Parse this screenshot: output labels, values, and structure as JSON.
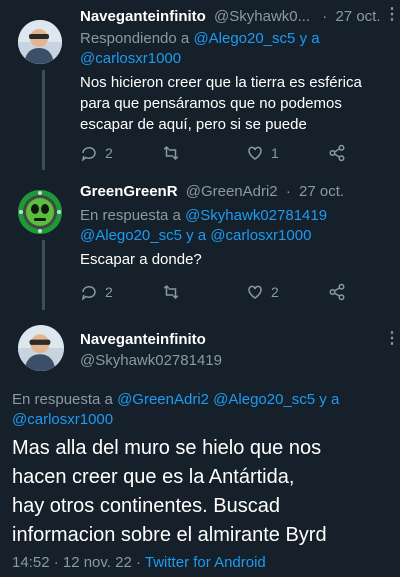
{
  "tweet1": {
    "name": "Naveganteinfinito",
    "handle": "@Skyhawk0...",
    "dot": "·",
    "time": "27 oct.",
    "reply_prefix": "Respondiendo a",
    "reply_to1": "@Alego20_sc5 y a",
    "reply_to2": "@carlosxr1000",
    "text_line1": "Nos hicieron creer que la tierra es esférica",
    "text_line2": "para que pensáramos que no podemos",
    "text_line3": "escapar de aquí, pero si se puede",
    "reply_count": "2",
    "retweet_count": "",
    "like_count": "1"
  },
  "tweet2": {
    "name": "GreenGreenR",
    "handle": "@GreenAdri2",
    "dot": "·",
    "time": "27 oct.",
    "reply_prefix": "En respuesta a",
    "reply_to1": "@Skyhawk02781419",
    "reply_to2": "@Alego20_sc5 y a @carlosxr1000",
    "text": "Escapar a donde?",
    "reply_count": "2",
    "retweet_count": "",
    "like_count": "2"
  },
  "tweet3": {
    "name": "Naveganteinfinito",
    "handle": "@Skyhawk02781419",
    "reply_prefix": "En respuesta a",
    "reply_to1": "@GreenAdri2 @Alego20_sc5 y a",
    "reply_to2": "@carlosxr1000",
    "text_line1": "Mas alla del muro se hielo que nos",
    "text_line2": "hacen creer que es la Antártida,",
    "text_line3": "hay otros continentes. Buscad",
    "text_line4": "informacion sobre el almirante Byrd",
    "timestamp": "14:52 · 12 nov. 22 ·",
    "source": "Twitter for Android"
  },
  "colors": {
    "background": "#15202b",
    "muted": "#8b98a5",
    "link": "#1d9bf0",
    "avatar_green": "#2dbf4a"
  },
  "icons": [
    "reply-icon",
    "retweet-icon",
    "like-icon",
    "share-icon",
    "more-icon"
  ]
}
